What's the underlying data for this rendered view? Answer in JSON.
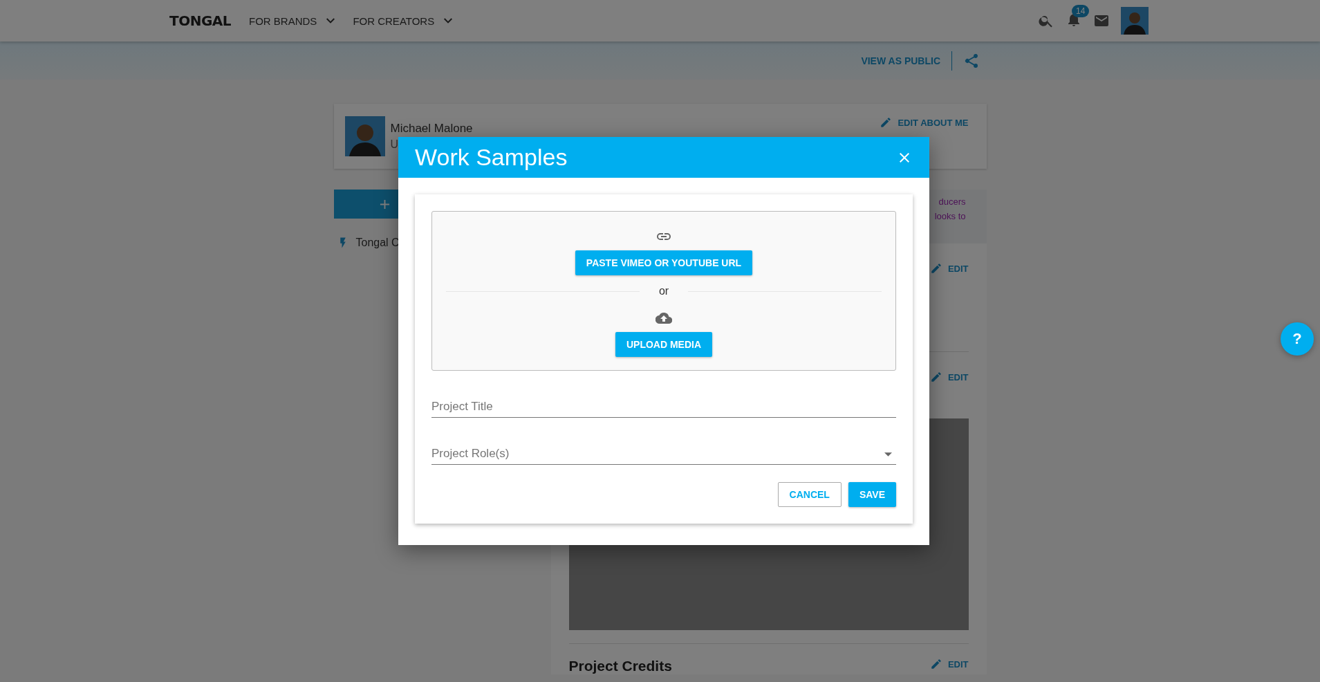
{
  "header": {
    "logo": "TONGAL",
    "nav": [
      {
        "label": "FOR BRANDS"
      },
      {
        "label": "FOR CREATORS"
      }
    ],
    "notification_count": "14"
  },
  "subbar": {
    "view_as_public": "VIEW AS PUBLIC"
  },
  "profile": {
    "name": "Michael Malone",
    "subtitle": "U",
    "edit": "EDIT ABOUT ME"
  },
  "sidebar": {
    "items": [
      {
        "label": "Tongal C"
      }
    ]
  },
  "content": {
    "note_lines": [
      "ducers",
      "looks to"
    ],
    "sections": [
      {
        "edit": "EDIT"
      },
      {
        "edit": "EDIT"
      }
    ],
    "project_credits": {
      "title": "Project Credits",
      "edit": "EDIT"
    }
  },
  "modal": {
    "title": "Work Samples",
    "paste_button": "PASTE VIMEO OR YOUTUBE URL",
    "divider_text": "or",
    "upload_button": "UPLOAD MEDIA",
    "fields": [
      {
        "kind": "text",
        "placeholder": "Project Title"
      },
      {
        "kind": "select",
        "placeholder": "Project Role(s)"
      }
    ],
    "buttons": [
      {
        "kind": "outline",
        "label": "CANCEL"
      },
      {
        "kind": "primary",
        "label": "SAVE"
      }
    ]
  },
  "help_button": "?"
}
